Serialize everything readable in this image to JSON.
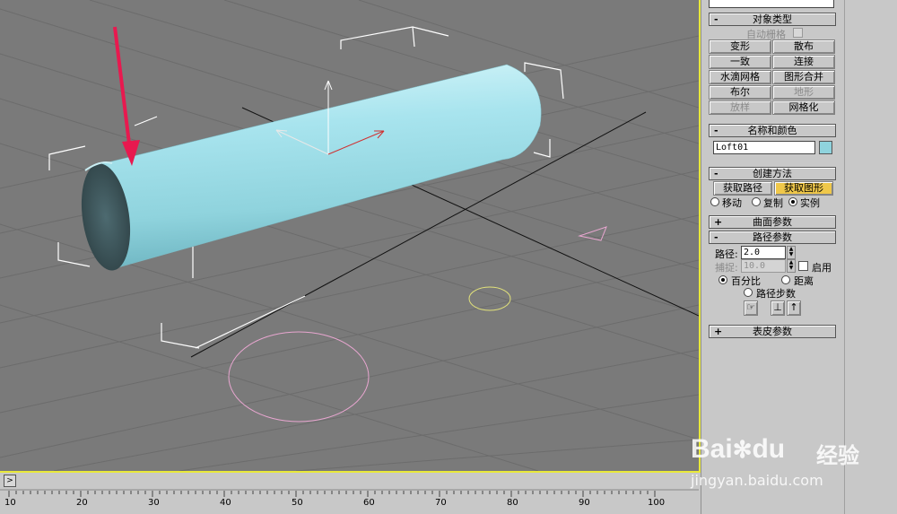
{
  "panel": {
    "top_placeholder": "",
    "object_type": {
      "title": "对象类型",
      "sign": "-",
      "autogrid_label": "自动栅格",
      "buttons": [
        "变形",
        "散布",
        "一致",
        "连接",
        "水滴网格",
        "图形合并",
        "布尔",
        "地形",
        "放样",
        "网格化"
      ]
    },
    "name_color": {
      "title": "名称和颜色",
      "sign": "-",
      "name_value": "Loft01",
      "color": "#8fd3dd"
    },
    "creation_method": {
      "title": "创建方法",
      "sign": "-",
      "get_path": "获取路径",
      "get_shape": "获取图形",
      "radio_move": "移动",
      "radio_copy": "复制",
      "radio_instance": "实例"
    },
    "surface_params": {
      "title": "曲面参数",
      "sign": "+"
    },
    "path_params": {
      "title": "路径参数",
      "sign": "-",
      "path_label": "路径:",
      "path_value": "2.0",
      "snap_label": "捕捉:",
      "snap_value": "10.0",
      "enable_label": "启用",
      "percent_label": "百分比",
      "distance_label": "距离",
      "path_steps_label": "路径步数"
    },
    "skin_params": {
      "title": "表皮参数",
      "sign": "+"
    }
  },
  "timeline": {
    "expand_glyph": ">",
    "ticks": [
      "10",
      "20",
      "30",
      "40",
      "50",
      "60",
      "70",
      "80",
      "90",
      "100"
    ]
  },
  "watermark": {
    "brand": "Bai",
    "brand2": "du",
    "cn": "经验",
    "url": "jingyan.baidu.com"
  },
  "colors": {
    "viewport_bg": "#7a7a7a",
    "active_border": "#e8e83a",
    "cylinder": "#9fe0ea",
    "annotation_arrow": "#e8194f"
  }
}
